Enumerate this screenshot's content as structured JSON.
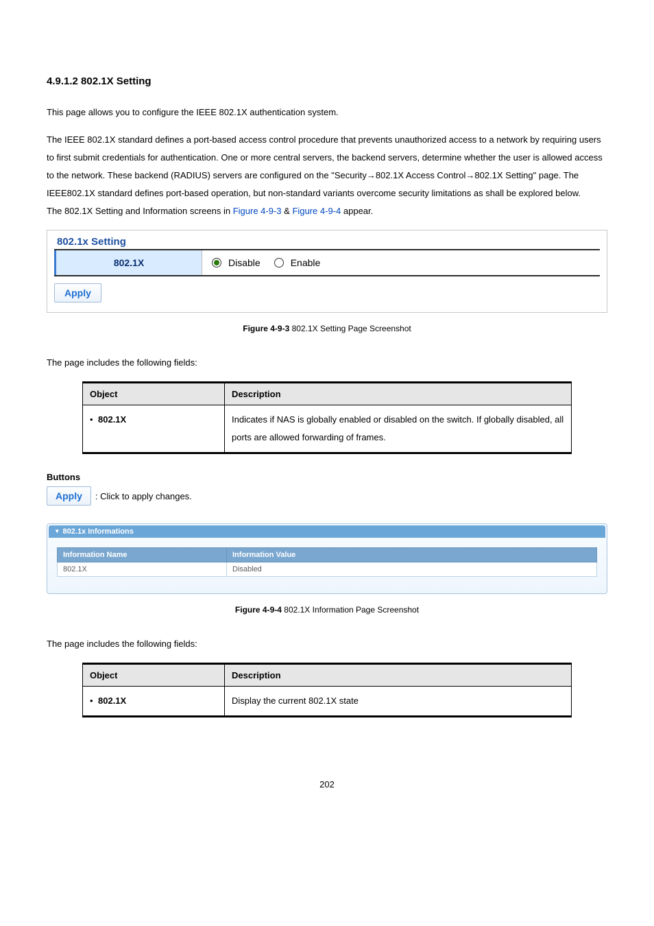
{
  "section_heading": "4.9.1.2 802.1X Setting",
  "intro_paragraph": "This page allows you to configure the IEEE 802.1X authentication system.",
  "main_paragraph_part1": "The IEEE 802.1X standard defines a port-based access control procedure that prevents unauthorized access to a network by requiring users to first submit credentials for authentication. One or more central servers, the backend servers, determine whether the user is allowed access to the network. These backend (RADIUS) servers are configured on the \"Security→802.1X Access Control→802.1X Setting\" page. The IEEE802.1X standard defines port-based operation, but non-standard variants overcome security limitations as shall be explored below.",
  "screens_sentence_prefix": "The 802.1X Setting and Information screens in ",
  "link_fig1": "Figure 4-9-3",
  "amp": " & ",
  "link_fig2": "Figure 4-9-4",
  "screens_sentence_suffix": " appear.",
  "fig1": {
    "panel_title": "802.1x Setting",
    "row_label": "802.1X",
    "option_disable": "Disable",
    "option_enable": "Enable",
    "apply_label": "Apply"
  },
  "fig1_caption_bold": "Figure 4-9-3",
  "fig1_caption_rest": " 802.1X Setting Page Screenshot",
  "fields_intro": "The page includes the following fields:",
  "fields_table_headers": {
    "object": "Object",
    "description": "Description"
  },
  "fields1": {
    "object": "802.1X",
    "description": "Indicates if NAS is globally enabled or disabled on the switch. If globally disabled, all ports are allowed forwarding of frames."
  },
  "buttons_heading": "Buttons",
  "apply_desc": ": Click to apply changes.",
  "fig2": {
    "header": "802.1x Informations",
    "col_name": "Information Name",
    "col_value": "Information Value",
    "row_name": "802.1X",
    "row_value": "Disabled"
  },
  "fig2_caption_bold": "Figure 4-9-4",
  "fig2_caption_rest": " 802.1X Information Page Screenshot",
  "fields2": {
    "object": "802.1X",
    "description": "Display the current 802.1X state"
  },
  "page_number": "202"
}
